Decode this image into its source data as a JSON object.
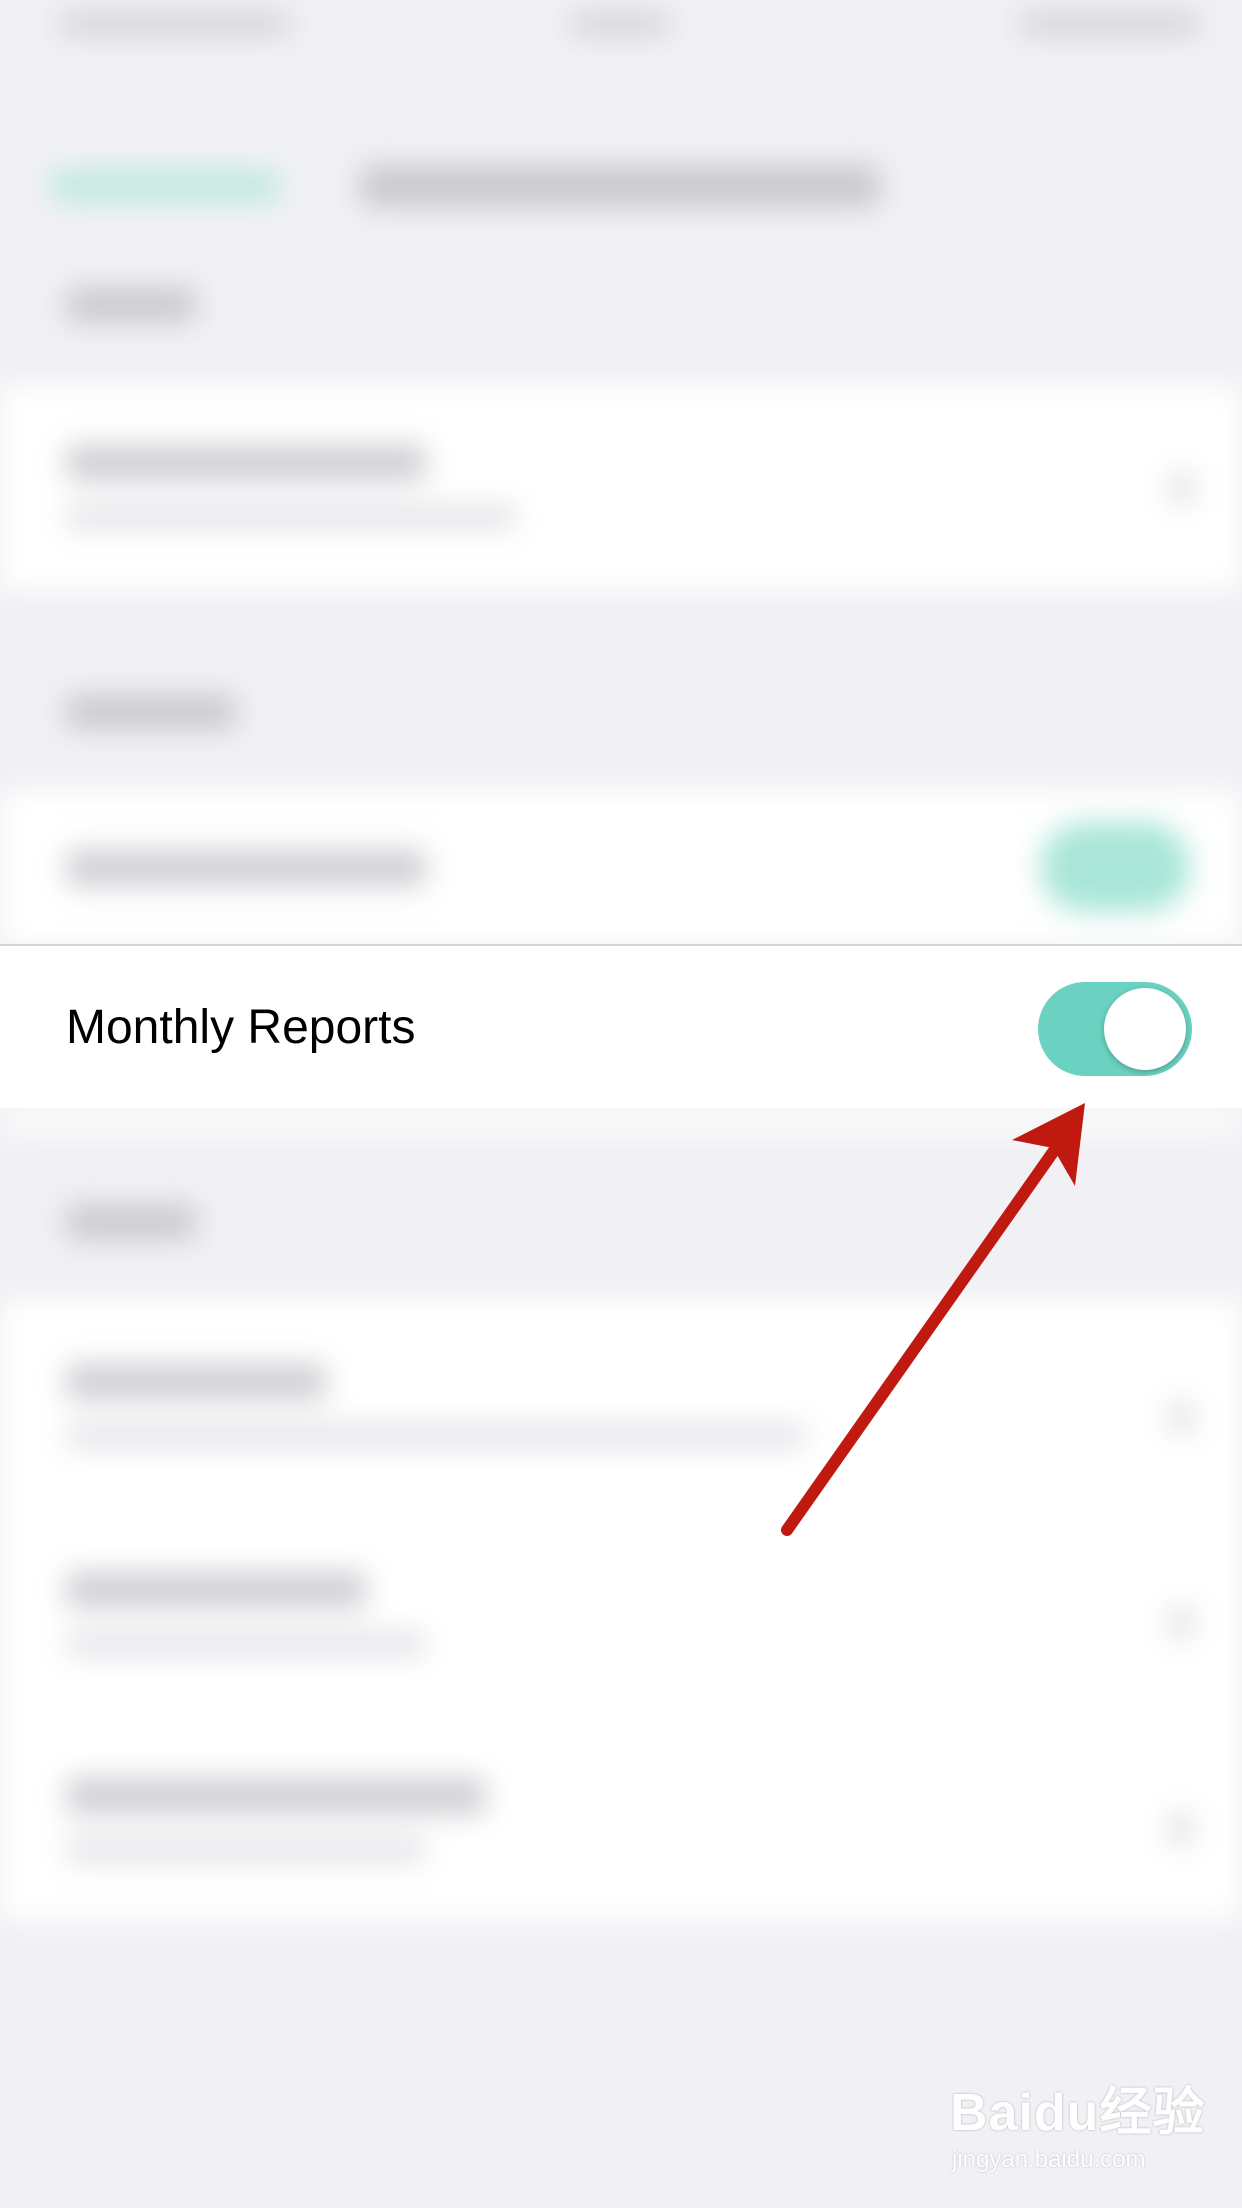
{
  "row": {
    "label": "Monthly Reports",
    "toggle_on": true
  },
  "colors": {
    "toggle_on": "#6bd1c1",
    "arrow": "#c01a10",
    "background": "#f1f1f5"
  },
  "watermark": {
    "brand": "Baidu经验",
    "url": "jingyan.baidu.com"
  },
  "icons": {
    "annotation": "red-arrow-icon"
  }
}
